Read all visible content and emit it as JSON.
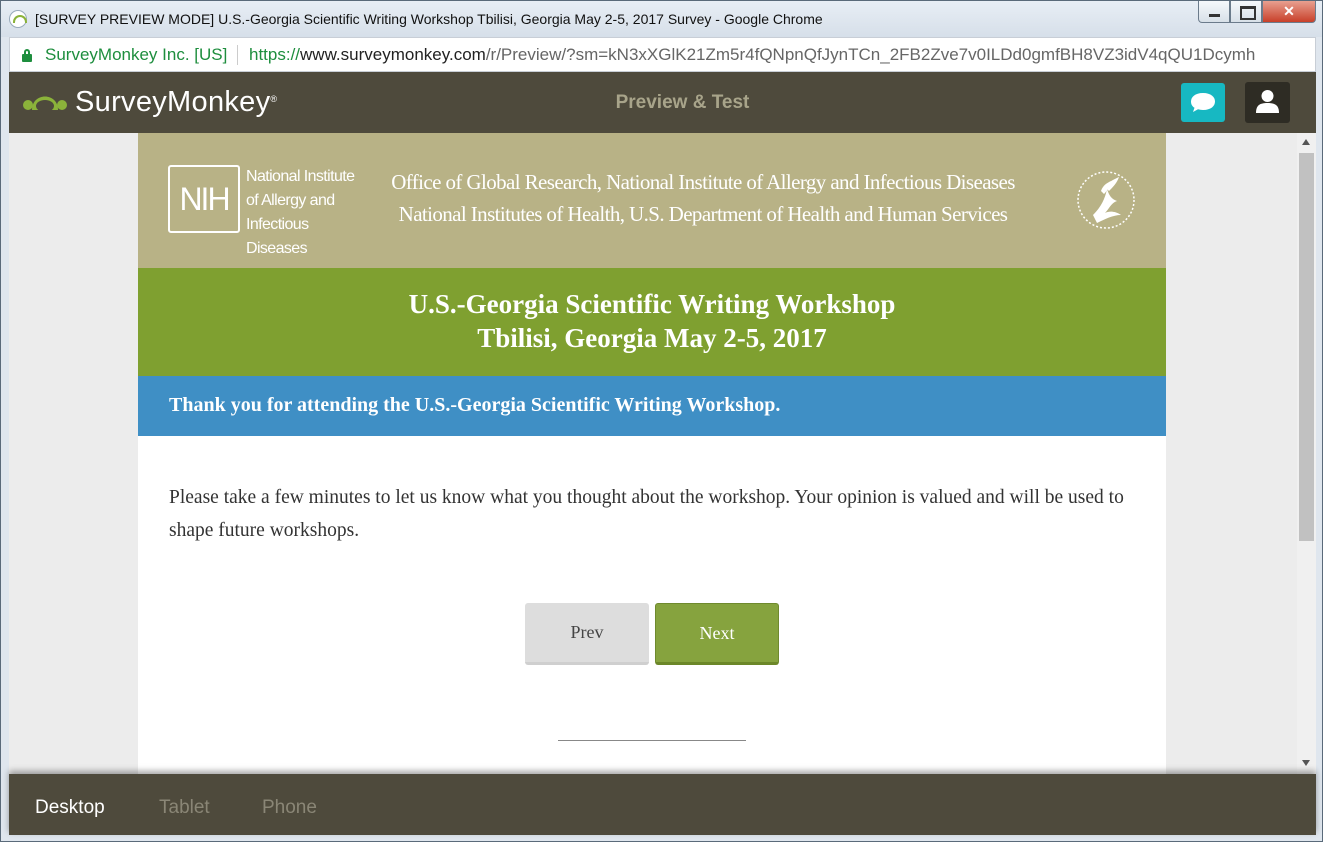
{
  "window": {
    "title": "[SURVEY PREVIEW MODE] U.S.-Georgia Scientific Writing Workshop Tbilisi, Georgia May 2-5, 2017 Survey - Google Chrome"
  },
  "address_bar": {
    "site_name": "SurveyMonkey Inc. [US]",
    "url_scheme": "https://",
    "url_host": "www.surveymonkey.com",
    "url_path": "/r/Preview/?sm=kN3xXGlK21Zm5r4fQNpnQfJynTCn_2FB2Zve7v0ILDd0gmfBH8VZ3idV4qQU1Dcymh"
  },
  "header": {
    "logo_text": "SurveyMonkey",
    "logo_mark": "®",
    "mode_label": "Preview & Test",
    "feedback_icon": "speech-bubble-icon",
    "account_icon": "user-icon"
  },
  "survey": {
    "nih_abbrev": "NIH",
    "nih_name": "National Institute of Allergy and Infectious Diseases",
    "office_line1": "Office of Global Research, National Institute of Allergy and Infectious Diseases",
    "office_line2": "National Institutes of Health, U.S. Department of Health and Human Services",
    "title_line1": "U.S.-Georgia Scientific Writing Workshop",
    "title_line2": "Tbilisi, Georgia May 2-5, 2017",
    "thanks": "Thank you for attending the U.S.-Georgia Scientific Writing Workshop.",
    "intro": "Please take a few minutes to let us know what you thought about the workshop. Your opinion is valued and will be used to shape future workshops.",
    "prev_label": "Prev",
    "next_label": "Next"
  },
  "device_bar": {
    "tabs": [
      {
        "label": "Desktop",
        "active": true
      },
      {
        "label": "Tablet",
        "active": false
      },
      {
        "label": "Phone",
        "active": false
      }
    ]
  },
  "colors": {
    "header_bg": "#4e4a3c",
    "nih_banner": "#b8b286",
    "title_banner": "#7fa030",
    "thanks_banner": "#3f8fc5",
    "next_button": "#86a33e",
    "feedback_button": "#17b8c2"
  }
}
